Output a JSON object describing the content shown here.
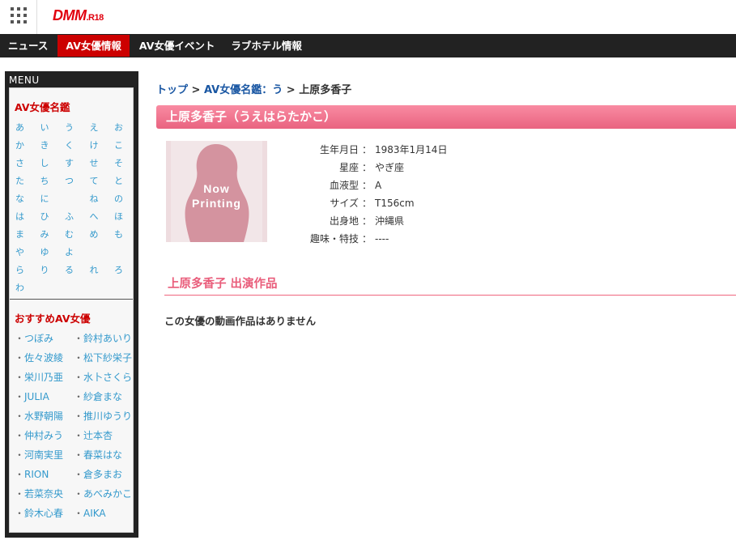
{
  "header": {
    "logo_main": "DMM",
    "logo_suffix": ".R18",
    "brand_color": "#e1000e"
  },
  "nav": {
    "items": [
      {
        "label": "ニュース",
        "active": false
      },
      {
        "label": "AV女優情報",
        "active": true
      },
      {
        "label": "AV女優イベント",
        "active": false
      },
      {
        "label": "ラブホテル情報",
        "active": false
      }
    ]
  },
  "sidebar": {
    "menu_label": "MENU",
    "directory_title": "AV女優名鑑",
    "kana_rows": [
      [
        "あ",
        "い",
        "う",
        "え",
        "お"
      ],
      [
        "か",
        "き",
        "く",
        "け",
        "こ"
      ],
      [
        "さ",
        "し",
        "す",
        "せ",
        "そ"
      ],
      [
        "た",
        "ち",
        "つ",
        "て",
        "と"
      ],
      [
        "な",
        "に",
        "",
        "ね",
        "の"
      ],
      [
        "は",
        "ひ",
        "ふ",
        "へ",
        "ほ"
      ],
      [
        "ま",
        "み",
        "む",
        "め",
        "も"
      ],
      [
        "や",
        "ゆ",
        "よ",
        "",
        ""
      ],
      [
        "ら",
        "り",
        "る",
        "れ",
        "ろ"
      ],
      [
        "わ",
        "",
        "",
        "",
        ""
      ]
    ],
    "recommended_title": "おすすめAV女優",
    "recommended": [
      "つぼみ",
      "鈴村あいり",
      "佐々波綾",
      "松下紗栄子",
      "栄川乃亜",
      "水卜さくら",
      "JULIA",
      "紗倉まな",
      "水野朝陽",
      "推川ゆうり",
      "仲村みう",
      "辻本杏",
      "河南実里",
      "春菜はな",
      "RION",
      "倉多まお",
      "若菜奈央",
      "あべみかこ",
      "鈴木心春",
      "AIKA"
    ],
    "bullet": "・"
  },
  "breadcrumb": {
    "top": "トップ",
    "separator": ">",
    "directory": "AV女優名鑑：う",
    "current": "上原多香子"
  },
  "actress": {
    "heading": "上原多香子（うえはらたかこ）",
    "photo_text_1": "Now",
    "photo_text_2": "Printing",
    "profile": [
      {
        "label": "生年月日",
        "value": "1983年1月14日"
      },
      {
        "label": "星座",
        "value": "やぎ座"
      },
      {
        "label": "血液型",
        "value": "A"
      },
      {
        "label": "サイズ",
        "value": "T156cm"
      },
      {
        "label": "出身地",
        "value": "沖縄県"
      },
      {
        "label": "趣味・特技",
        "value": "----"
      }
    ],
    "colon": "："
  },
  "works": {
    "title": "上原多香子 出演作品",
    "empty_message": "この女優の動画作品はありません"
  },
  "colors": {
    "accent_pink": "#e96380",
    "link_blue": "#1a57a3",
    "sidebar_link": "#39c",
    "section_red": "#cc0000"
  }
}
